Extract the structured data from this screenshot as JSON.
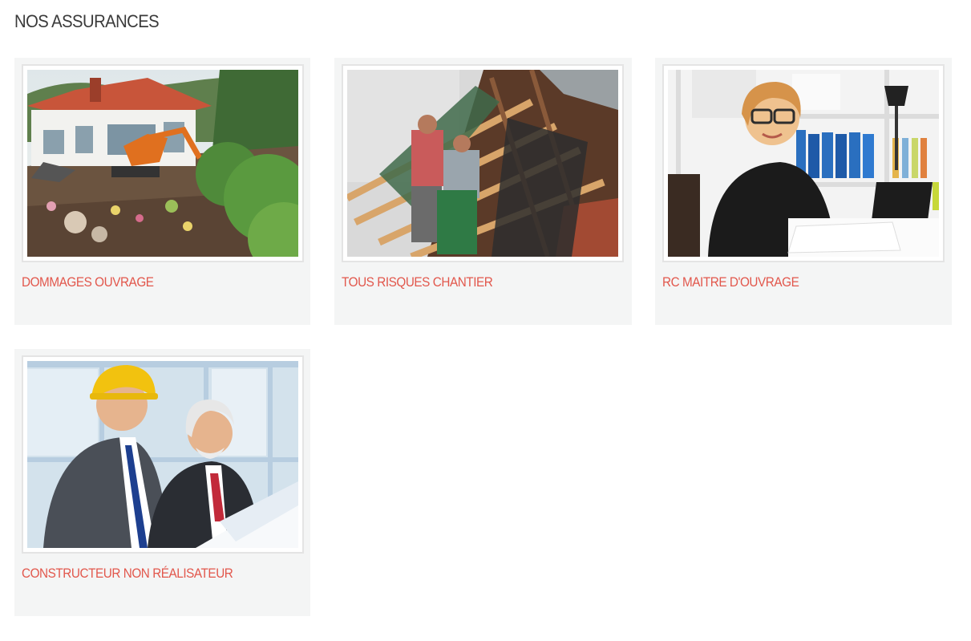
{
  "page": {
    "title": "NOS ASSURANCES"
  },
  "colors": {
    "accent": "#e2574c",
    "card_bg": "#f4f5f5",
    "title": "#3a3a3a"
  },
  "cards": [
    {
      "label": "DOMMAGES OUVRAGE"
    },
    {
      "label": "TOUS RISQUES CHANTIER"
    },
    {
      "label": "RC MAITRE D'OUVRAGE"
    },
    {
      "label": "CONSTRUCTEUR NON RÉALISATEUR"
    }
  ]
}
